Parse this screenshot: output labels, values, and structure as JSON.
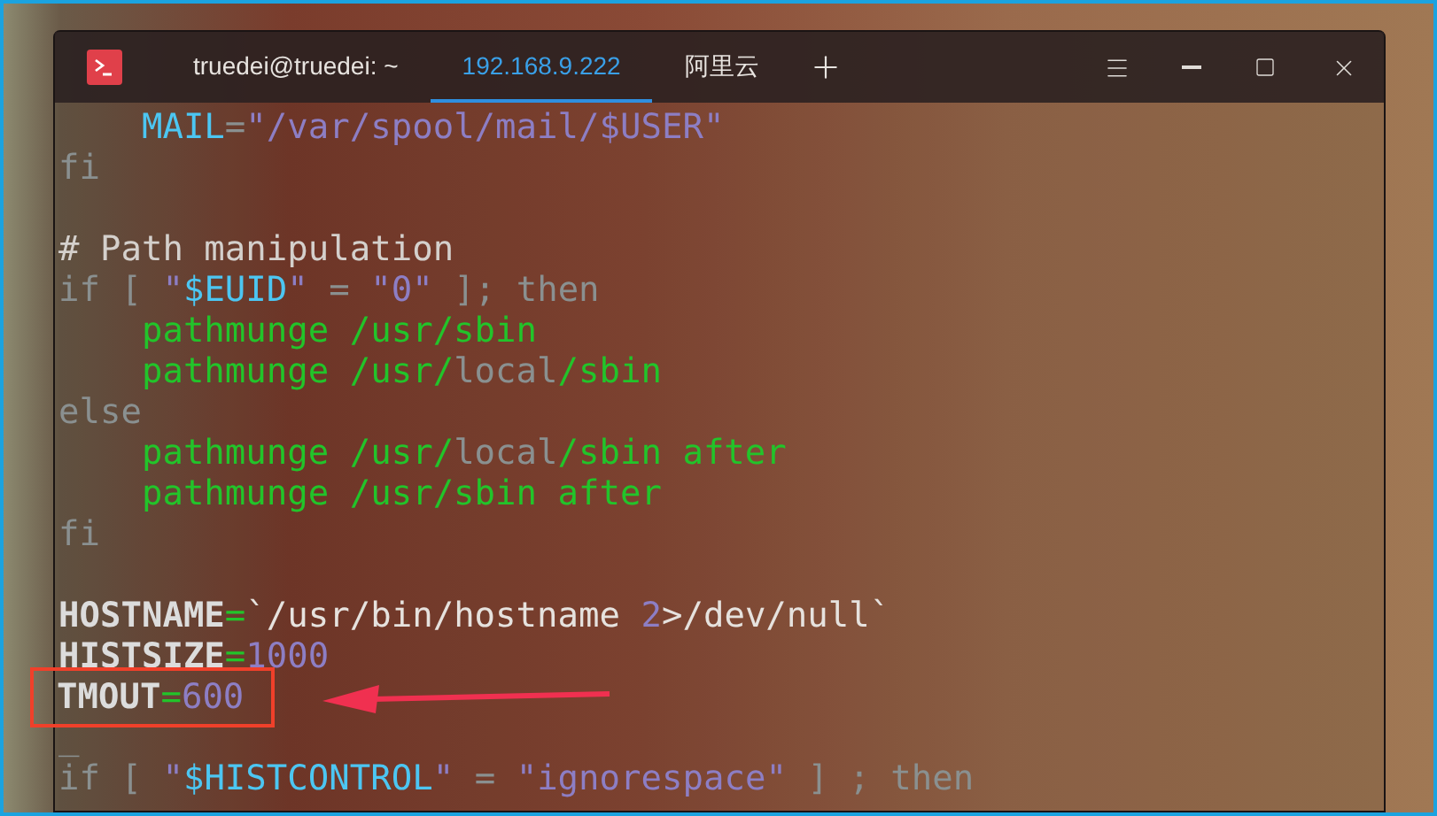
{
  "window": {
    "tabs": [
      {
        "label": "truedei@truedei: ~",
        "selected": false
      },
      {
        "label": "192.168.9.222",
        "selected": true
      },
      {
        "label": "阿里云",
        "selected": false
      }
    ]
  },
  "editor": {
    "lines": [
      {
        "kind": "code",
        "tokens": [
          {
            "text": "    MAIL",
            "kind": "var"
          },
          {
            "text": "=",
            "kind": "kw"
          },
          {
            "text": "\"/var/spool/mail/$USER\"",
            "kind": "str"
          }
        ]
      },
      {
        "kind": "code",
        "tokens": [
          {
            "text": "fi",
            "kind": "kw"
          }
        ]
      },
      {
        "kind": "blank"
      },
      {
        "kind": "code",
        "tokens": [
          {
            "text": "# Path manipulation",
            "kind": "comment"
          }
        ]
      },
      {
        "kind": "code",
        "tokens": [
          {
            "text": "if [ ",
            "kind": "kw"
          },
          {
            "text": "\"",
            "kind": "str"
          },
          {
            "text": "$EUID",
            "kind": "var"
          },
          {
            "text": "\"",
            "kind": "str"
          },
          {
            "text": " = ",
            "kind": "kw"
          },
          {
            "text": "\"0\"",
            "kind": "str"
          },
          {
            "text": " ]; then",
            "kind": "kw"
          }
        ]
      },
      {
        "kind": "code",
        "tokens": [
          {
            "text": "    pathmunge /usr/sbin",
            "kind": "cmd"
          }
        ]
      },
      {
        "kind": "code",
        "tokens": [
          {
            "text": "    pathmunge /usr/",
            "kind": "cmd"
          },
          {
            "text": "local",
            "kind": "kw"
          },
          {
            "text": "/sbin",
            "kind": "cmd"
          }
        ]
      },
      {
        "kind": "code",
        "tokens": [
          {
            "text": "else",
            "kind": "kw"
          }
        ]
      },
      {
        "kind": "code",
        "tokens": [
          {
            "text": "    pathmunge /usr/",
            "kind": "cmd"
          },
          {
            "text": "local",
            "kind": "kw"
          },
          {
            "text": "/sbin after",
            "kind": "cmd"
          }
        ]
      },
      {
        "kind": "code",
        "tokens": [
          {
            "text": "    pathmunge /usr/sbin after",
            "kind": "cmd"
          }
        ]
      },
      {
        "kind": "code",
        "tokens": [
          {
            "text": "fi",
            "kind": "kw"
          }
        ]
      },
      {
        "kind": "blank"
      },
      {
        "kind": "code",
        "tokens": [
          {
            "text": "HOSTNAME",
            "kind": "name"
          },
          {
            "text": "=",
            "kind": "op"
          },
          {
            "text": "`/usr/bin/hostname ",
            "kind": "plain"
          },
          {
            "text": "2",
            "kind": "num"
          },
          {
            "text": ">/dev/null`",
            "kind": "plain"
          }
        ]
      },
      {
        "kind": "code",
        "tokens": [
          {
            "text": "HISTSIZE",
            "kind": "name"
          },
          {
            "text": "=",
            "kind": "op"
          },
          {
            "text": "1000",
            "kind": "num"
          }
        ]
      },
      {
        "kind": "code",
        "highlighted": true,
        "tokens": [
          {
            "text": "TMOUT",
            "kind": "name"
          },
          {
            "text": "=",
            "kind": "op"
          },
          {
            "text": "600",
            "kind": "num"
          }
        ]
      },
      {
        "kind": "code",
        "tokens": [
          {
            "text": "_",
            "kind": "kw"
          }
        ]
      },
      {
        "kind": "code",
        "tokens": [
          {
            "text": "if [ ",
            "kind": "kw"
          },
          {
            "text": "\"",
            "kind": "str"
          },
          {
            "text": "$HISTCONTROL",
            "kind": "var"
          },
          {
            "text": "\"",
            "kind": "str"
          },
          {
            "text": " = ",
            "kind": "kw"
          },
          {
            "text": "\"ignorespace\"",
            "kind": "str"
          },
          {
            "text": " ] ; then",
            "kind": "kw"
          }
        ]
      }
    ]
  }
}
